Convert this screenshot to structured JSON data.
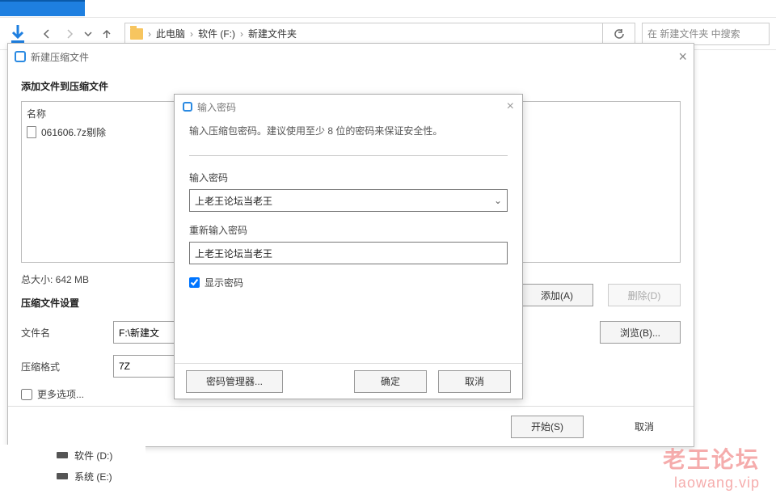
{
  "nav": {
    "breadcrumb": {
      "a": "此电脑",
      "b": "软件 (F:)",
      "c": "新建文件夹"
    },
    "search_placeholder": "在 新建文件夹 中搜索"
  },
  "sidebar": {
    "items": [
      {
        "label": "软件 (D:)"
      },
      {
        "label": "系统 (E:)"
      }
    ]
  },
  "dlg1": {
    "title": "新建压缩文件",
    "section_add": "添加文件到压缩文件",
    "col_name": "名称",
    "file_row": "061606.7z剔除",
    "total_label": "总大小: 642 MB",
    "btn_add": "添加(A)",
    "btn_remove": "删除(D)",
    "settings": "压缩文件设置",
    "fn_label": "文件名",
    "fn_value": "F:\\新建文",
    "fmt_label": "压缩格式",
    "fmt_value": "7Z",
    "btn_browse": "浏览(B)...",
    "more": "更多选项...",
    "btn_start": "开始(S)",
    "btn_cancel": "取消"
  },
  "dlg2": {
    "title": "输入密码",
    "msg": "输入压缩包密码。建议使用至少 8 位的密码来保证安全性。",
    "pw1_label": "输入密码",
    "pw1_value": "上老王论坛当老王",
    "pw2_label": "重新输入密码",
    "pw2_value": "上老王论坛当老王",
    "show_pw": "显示密码",
    "btn_mgr": "密码管理器...",
    "btn_ok": "确定",
    "btn_cancel": "取消"
  },
  "watermark": {
    "l1": "老王论坛",
    "l2": "laowang.vip"
  }
}
